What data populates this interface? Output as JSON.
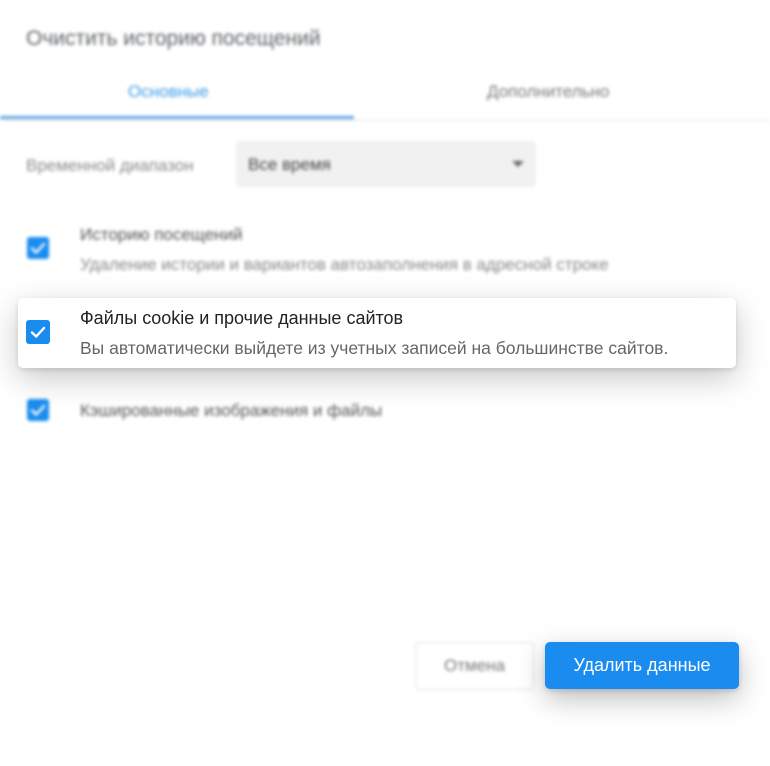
{
  "dialog": {
    "title": "Очистить историю посещений",
    "tabs": [
      {
        "label": "Основные",
        "active": true
      },
      {
        "label": "Дополнительно",
        "active": false
      }
    ],
    "time_range": {
      "label": "Временной диапазон",
      "value": "Все время"
    },
    "options": [
      {
        "title": "Историю посещений",
        "description": "Удаление истории и вариантов автозаполнения в адресной строке",
        "checked": true
      },
      {
        "title": "Файлы cookie и прочие данные сайтов",
        "description": "Вы автоматически выйдете из учетных записей на большинстве сайтов.",
        "checked": true
      },
      {
        "title": "Кэшированные изображения и файлы",
        "checked": true
      }
    ],
    "buttons": {
      "cancel": "Отмена",
      "delete": "Удалить данные"
    },
    "colors": {
      "accent": "#1a8cf0",
      "tab_active": "#3b9be8"
    }
  }
}
